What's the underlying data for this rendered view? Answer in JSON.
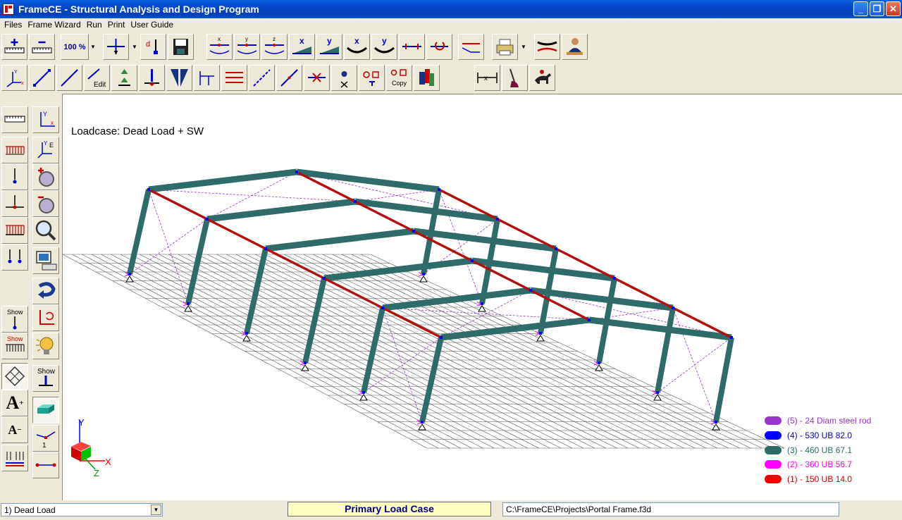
{
  "window": {
    "title": "FrameCE - Structural Analysis and Design Program"
  },
  "menu": [
    "Files",
    "Frame Wizard",
    "Run",
    "Print",
    "User Guide"
  ],
  "toolbar": {
    "zoom_label": "100 %",
    "copy_label": "Copy",
    "edit_label": "Edit"
  },
  "sidebar": {
    "show_loads_label": "Show",
    "show_dist_label": "Show",
    "show_supports_label": "Show"
  },
  "canvas": {
    "loadcase_label": "Loadcase: Dead Load + SW",
    "axes": {
      "x": "X",
      "y": "Y",
      "z": "Z"
    }
  },
  "legend": [
    {
      "label": "(5) -  24 Diam steel rod",
      "color": "#9933cc"
    },
    {
      "label": "(4) - 530 UB 82.0",
      "color": "#0000ff"
    },
    {
      "label": "(3) - 460 UB 67.1",
      "color": "#2f6b68"
    },
    {
      "label": "(2) - 360 UB 56.7",
      "color": "#ff00ff"
    },
    {
      "label": "(1) - 150 UB 14.0",
      "color": "#ee0000"
    }
  ],
  "status": {
    "load_case_select": "1) Dead Load",
    "primary_label": "Primary Load Case",
    "file_path": "C:\\FrameCE\\Projects\\Portal Frame.f3d"
  }
}
